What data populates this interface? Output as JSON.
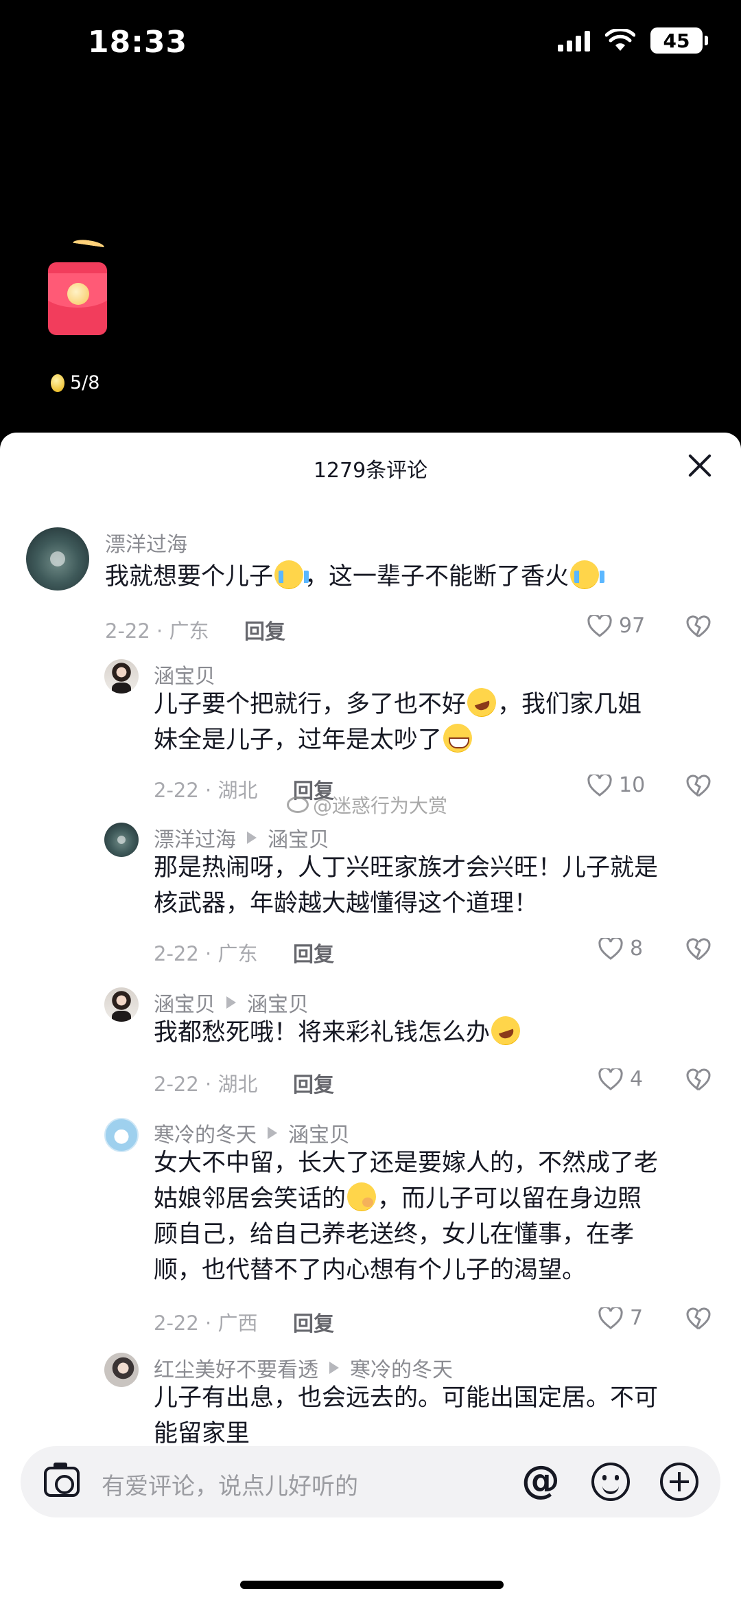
{
  "status_bar": {
    "time": "18:33",
    "battery": "45"
  },
  "reward": {
    "counter": "5/8"
  },
  "comments_panel": {
    "title": "1279条评论"
  },
  "comments": [
    {
      "user": "漂洋过海",
      "text_parts": [
        "我就想要个儿子",
        "，这一辈子不能断了香火"
      ],
      "date_location": "2-22 · 广东",
      "reply": "回复",
      "likes": "97"
    },
    {
      "user": "涵宝贝",
      "text_line1": "儿子要个把就行，多了也不好",
      "text_line1b": "，我们家几姐",
      "text_line2": "妹全是儿子，过年是太吵了",
      "date_location": "2-22 · 湖北",
      "reply": "回复",
      "likes": "10"
    },
    {
      "user": "漂洋过海",
      "reply_to": "涵宝贝",
      "text_line1": "那是热闹呀，人丁兴旺家族才会兴旺！儿子就是",
      "text_line2": "核武器，年龄越大越懂得这个道理！",
      "date_location": "2-22 · 广东",
      "reply": "回复",
      "likes": "8"
    },
    {
      "user": "涵宝贝",
      "reply_to": "涵宝贝",
      "text_line1": "我都愁死哦！将来彩礼钱怎么办",
      "date_location": "2-22 · 湖北",
      "reply": "回复",
      "likes": "4"
    },
    {
      "user": "寒冷的冬天",
      "reply_to": "涵宝贝",
      "text_line1": "女大不中留，长大了还是要嫁人的，不然成了老",
      "text_line2a": "姑娘邻居会笑话的",
      "text_line2b": "，而儿子可以留在身边照",
      "text_line3": "顾自己，给自己养老送终，女儿在懂事，在孝",
      "text_line4": "顺，也代替不了内心想有个儿子的渴望。",
      "date_location": "2-22 · 广西",
      "reply": "回复",
      "likes": "7"
    },
    {
      "user": "红尘美好不要看透",
      "reply_to": "寒冷的冬天",
      "text_line1": "儿子有出息，也会远去的。可能出国定居。不可",
      "text_line2": "能留家里"
    }
  ],
  "watermark": "@迷惑行为大赏",
  "input": {
    "placeholder": "有爱评论，说点儿好听的",
    "at_symbol": "@"
  },
  "colors": {
    "panel_bg": "#ffffff",
    "screen_bg": "#000000",
    "envelope": "#f23d5c"
  }
}
